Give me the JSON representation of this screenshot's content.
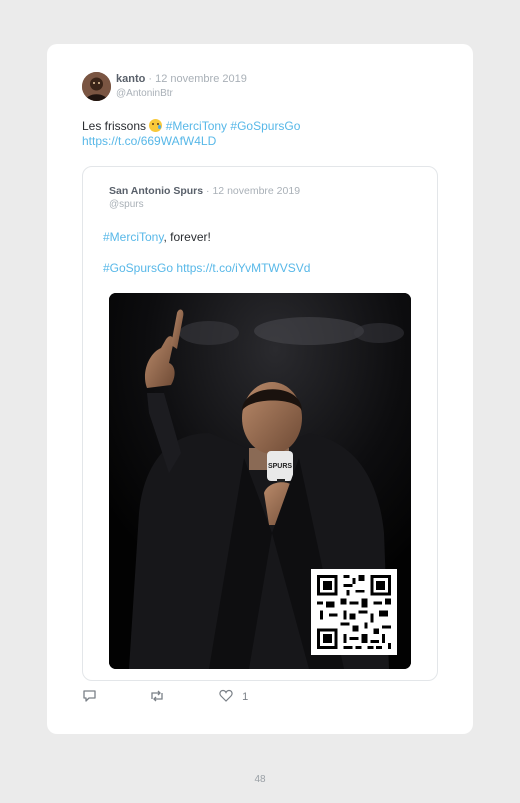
{
  "tweet": {
    "author_name": "kanto",
    "separator": " · ",
    "date": "12 novembre 2019",
    "handle": "@AntoninBtr",
    "text_prefix": "Les frissons ",
    "hashtag1": "#MerciTony",
    "hashtag2": "#GoSpursGo",
    "link": "https://t.co/669WAfW4LD",
    "emoji": "crying-face"
  },
  "quoted": {
    "author_name": "San Antonio Spurs",
    "separator": " · ",
    "date": "12 novembre 2019",
    "handle": "@spurs",
    "hashtag1": "#MerciTony",
    "text_after_hashtag": ", forever!",
    "hashtag2": "#GoSpursGo",
    "link": "https://t.co/iYvMTWVSVd"
  },
  "actions": {
    "reply_icon": "reply-icon",
    "retweet_icon": "retweet-icon",
    "like_icon": "heart-icon",
    "like_count": "1"
  },
  "footer": {
    "page_number": "48"
  },
  "colors": {
    "link": "#58b8e8",
    "background": "#ebebeb",
    "card": "#ffffff"
  }
}
